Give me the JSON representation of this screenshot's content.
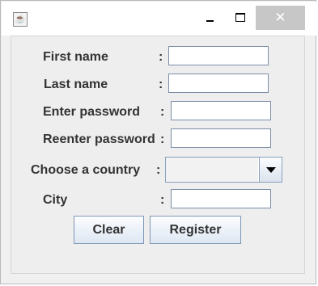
{
  "window": {
    "app_icon": "java-icon",
    "buttons": {
      "minimize_icon": "minimize-icon",
      "maximize_icon": "maximize-icon",
      "close_label": "✕"
    }
  },
  "form": {
    "first_name_label": "First name",
    "last_name_label": "Last name",
    "password_label": "Enter password",
    "reenter_password_label": "Reenter password",
    "country_label": "Choose a country",
    "city_label": "City",
    "colon": ":",
    "first_name_value": "",
    "last_name_value": "",
    "password_value": "",
    "reenter_password_value": "",
    "country_value": "",
    "city_value": ""
  },
  "actions": {
    "clear_label": "Clear",
    "register_label": "Register"
  }
}
